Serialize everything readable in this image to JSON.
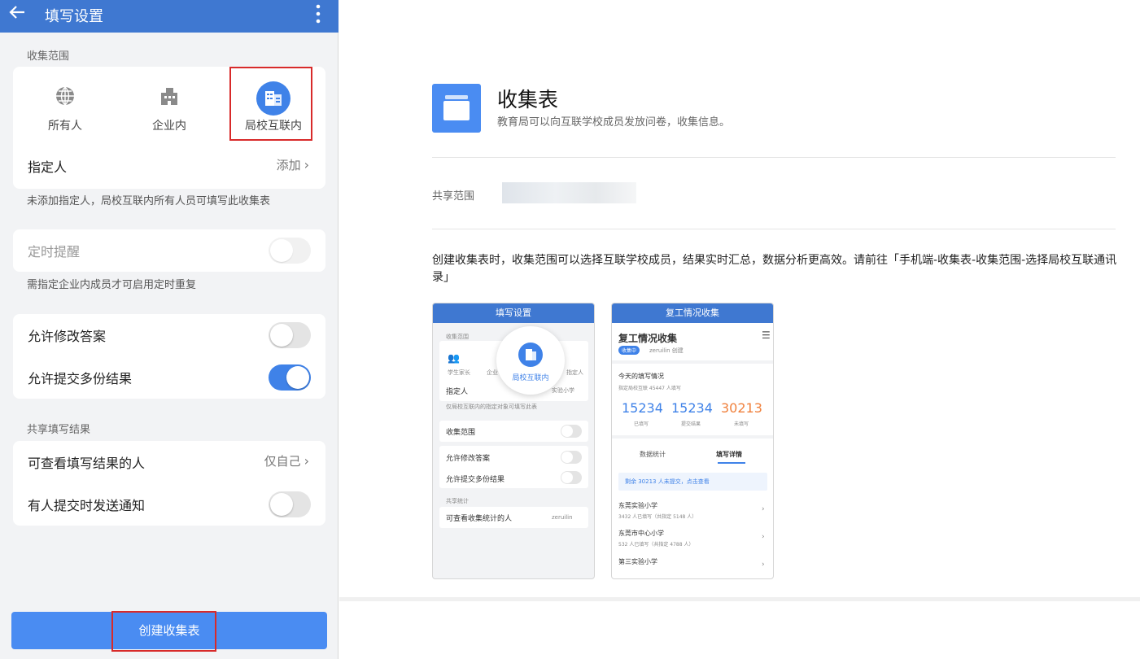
{
  "left": {
    "header": {
      "back_icon": "arrow-left-icon",
      "title": "填写设置",
      "more_icon": "more-vertical-icon"
    },
    "scope_label": "收集范围",
    "scope_options": [
      {
        "label": "所有人",
        "icon": "globe-icon"
      },
      {
        "label": "企业内",
        "icon": "building-icon"
      },
      {
        "label": "局校互联内",
        "icon": "school-building-icon",
        "selected": true
      }
    ],
    "designee": {
      "label": "指定人",
      "action": "添加"
    },
    "designee_hint": "未添加指定人，局校互联内所有人员可填写此收集表",
    "reminder": {
      "label": "定时提醒",
      "enabled": false,
      "disabled": true
    },
    "reminder_hint": "需指定企业内成员才可启用定时重复",
    "allow_edit": {
      "label": "允许修改答案",
      "on": false
    },
    "allow_multi": {
      "label": "允许提交多份结果",
      "on": true
    },
    "share_label": "共享填写结果",
    "viewers": {
      "label": "可查看填写结果的人",
      "value": "仅自己"
    },
    "notify": {
      "label": "有人提交时发送通知",
      "on": false
    },
    "create_button": "创建收集表"
  },
  "right": {
    "title": "收集表",
    "subtitle": "教育局可以向互联学校成员发放问卷，收集信息。",
    "share_scope_label": "共享范围",
    "description": "创建收集表时，收集范围可以选择互联学校成员，结果实时汇总，数据分析更高效。请前往「手机端-收集表-收集范围-选择局校互联通讯录」",
    "shot1": {
      "bar": "填写设置",
      "scope_label": "收集范围",
      "opt1": "学生家长",
      "opt2": "企业",
      "opt3": "局校互联内",
      "opt4": "指定人",
      "designee": "指定人",
      "designee_val": "实验小学",
      "hint": "仅局校互联内的指定对象可填写此表",
      "row1": "收集范围",
      "row2": "允许修改答案",
      "row3": "允许提交多份结果",
      "share": "共享统计",
      "row4": "可查看收集统计的人",
      "row4_val": "zeruilin"
    },
    "shot2": {
      "bar": "复工情况收集",
      "title": "复工情况收集",
      "badge": "收集中",
      "creator": "zeruilin 创建",
      "today": "今天的填写情况",
      "today_sub": "指定局校互联 45447 人填写",
      "stats": [
        {
          "value": "15234",
          "label": "已填写",
          "color": "#3f82e8"
        },
        {
          "value": "15234",
          "label": "提交结果",
          "color": "#3f82e8"
        },
        {
          "value": "30213",
          "label": "未填写",
          "color": "#f0803c"
        }
      ],
      "tab1": "数据统计",
      "tab2": "填写详情",
      "notice": "剩余 30213 人未提交，点击查看",
      "schools": [
        {
          "name": "东莞实验小学",
          "sub": "3432 人已填写（共指定 5148 人）"
        },
        {
          "name": "东莞市中心小学",
          "sub": "532 人已填写（共指定 4788 人）"
        },
        {
          "name": "第三实验小学",
          "sub": ""
        }
      ]
    }
  }
}
